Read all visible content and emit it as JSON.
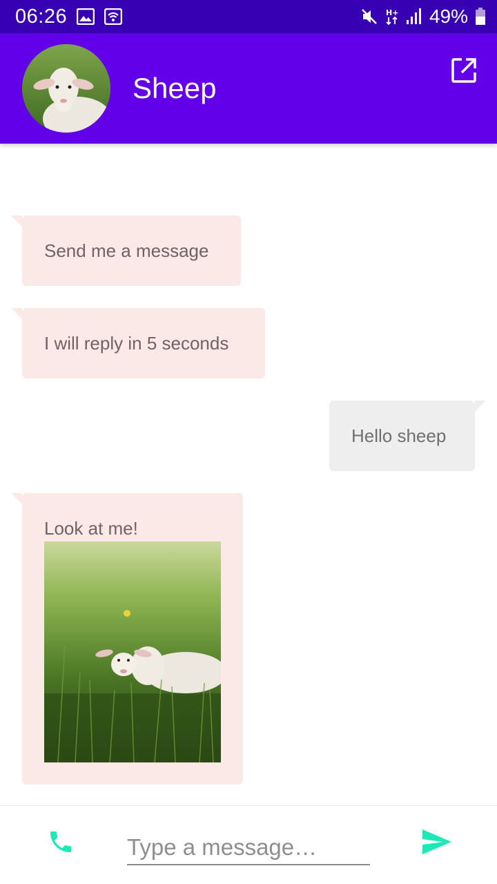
{
  "status_bar": {
    "time": "06:26",
    "battery_percent": "49%",
    "icons": [
      "image-icon",
      "wifi-icon",
      "mute-icon",
      "hplus-data-icon",
      "signal-icon",
      "battery-icon"
    ]
  },
  "app_bar": {
    "contact_name": "Sheep",
    "color": "#6200ea",
    "actions": [
      "open-external-icon"
    ]
  },
  "messages": [
    {
      "direction": "incoming",
      "text": "Send me a message"
    },
    {
      "direction": "incoming",
      "text": "I will reply in 5 seconds"
    },
    {
      "direction": "outgoing",
      "text": "Hello sheep"
    },
    {
      "direction": "incoming",
      "text": "Look at me!",
      "has_image": true
    }
  ],
  "input_bar": {
    "placeholder": "Type a message…",
    "value": "",
    "accent_color": "#1de9b6",
    "icons": [
      "phone-icon",
      "send-icon"
    ]
  },
  "colors": {
    "status_bar": "#3700b3",
    "incoming_bubble": "#fbe9e7",
    "outgoing_bubble": "#eeeeee"
  }
}
